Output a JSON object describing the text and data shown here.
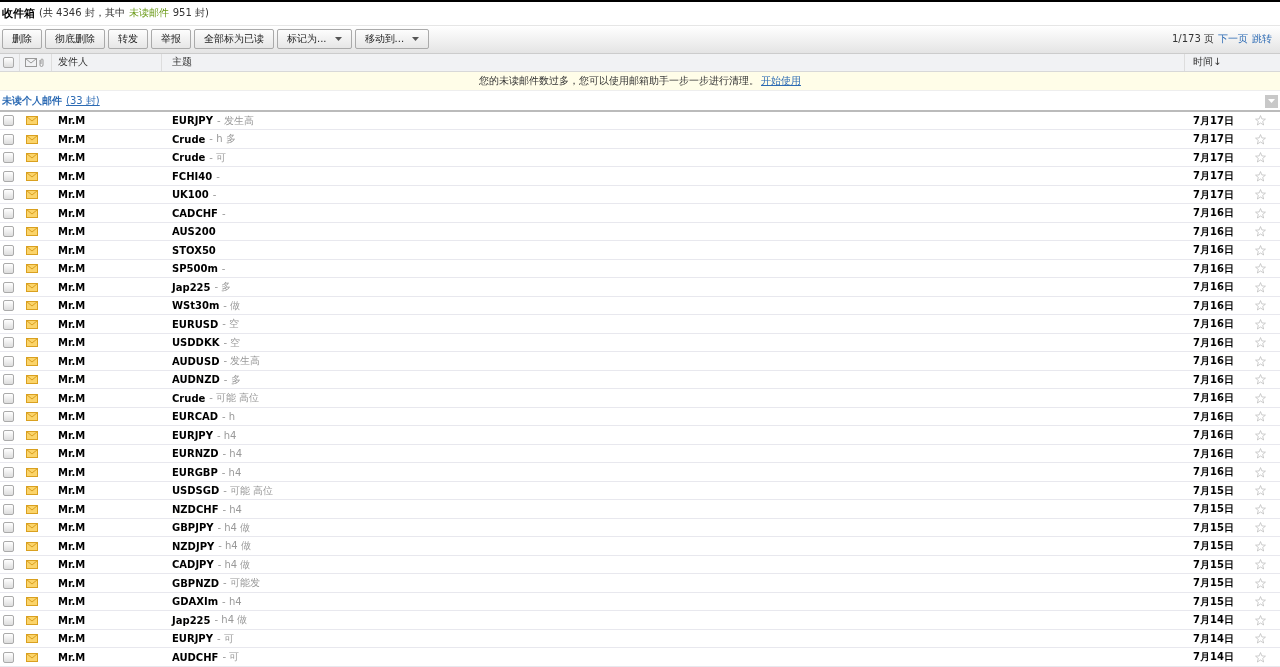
{
  "header": {
    "title": "收件箱",
    "summary_before": "(共 4346 封，其中",
    "unread_label": "未读邮件",
    "summary_after": "951 封)"
  },
  "toolbar": {
    "buttons": [
      {
        "label": "删除",
        "dropdown": false
      },
      {
        "label": "彻底删除",
        "dropdown": false
      },
      {
        "label": "转发",
        "dropdown": false
      },
      {
        "label": "举报",
        "dropdown": false
      },
      {
        "label": "全部标为已读",
        "dropdown": false
      },
      {
        "label": "标记为...",
        "dropdown": true
      },
      {
        "label": "移动到...",
        "dropdown": true
      }
    ],
    "pager": {
      "page": "1/173 页",
      "next": "下一页",
      "jump": "跳转"
    }
  },
  "columns": {
    "select_all": false,
    "sender": "发件人",
    "subject": "主题",
    "time": "时间↓"
  },
  "notice": {
    "text": "您的未读邮件数过多，您可以使用邮箱助手一步一步进行清理。",
    "link": "开始使用"
  },
  "group": {
    "title": "未读个人邮件",
    "count": "(33 封)"
  },
  "rows": [
    {
      "sender": "Mr.M",
      "subject": "EURJPY",
      "preview": "- 发生高",
      "time": "7月17日",
      "unread": true,
      "checked": false,
      "starred": false
    },
    {
      "sender": "Mr.M",
      "subject": "Crude",
      "preview": "- h 多",
      "time": "7月17日",
      "unread": true,
      "checked": false,
      "starred": false
    },
    {
      "sender": "Mr.M",
      "subject": "Crude",
      "preview": "- 可",
      "time": "7月17日",
      "unread": true,
      "checked": false,
      "starred": false
    },
    {
      "sender": "Mr.M",
      "subject": "FCHI40",
      "preview": "-",
      "time": "7月17日",
      "unread": true,
      "checked": false,
      "starred": false
    },
    {
      "sender": "Mr.M",
      "subject": "UK100",
      "preview": "-",
      "time": "7月17日",
      "unread": true,
      "checked": false,
      "starred": false
    },
    {
      "sender": "Mr.M",
      "subject": "CADCHF",
      "preview": "-",
      "time": "7月16日",
      "unread": true,
      "checked": false,
      "starred": false
    },
    {
      "sender": "Mr.M",
      "subject": "AUS200",
      "time": "7月16日",
      "unread": true,
      "checked": false,
      "starred": false
    },
    {
      "sender": "Mr.M",
      "subject": "STOX50",
      "time": "7月16日",
      "unread": true,
      "checked": false,
      "starred": false
    },
    {
      "sender": "Mr.M",
      "subject": "SP500m",
      "preview": "-",
      "time": "7月16日",
      "unread": true,
      "checked": false,
      "starred": false
    },
    {
      "sender": "Mr.M",
      "subject": "Jap225",
      "preview": "- 多",
      "time": "7月16日",
      "unread": true,
      "checked": false,
      "starred": false
    },
    {
      "sender": "Mr.M",
      "subject": "WSt30m",
      "preview": "- 做",
      "time": "7月16日",
      "unread": true,
      "checked": false,
      "starred": false
    },
    {
      "sender": "Mr.M",
      "subject": "EURUSD",
      "preview": "- 空",
      "time": "7月16日",
      "unread": true,
      "checked": false,
      "starred": false
    },
    {
      "sender": "Mr.M",
      "subject": "USDDKK",
      "preview": "- 空",
      "time": "7月16日",
      "unread": true,
      "checked": false,
      "starred": false
    },
    {
      "sender": "Mr.M",
      "subject": "AUDUSD",
      "preview": "- 发生高",
      "time": "7月16日",
      "unread": true,
      "checked": false,
      "starred": false
    },
    {
      "sender": "Mr.M",
      "subject": "AUDNZD",
      "preview": "- 多",
      "time": "7月16日",
      "unread": true,
      "checked": false,
      "starred": false
    },
    {
      "sender": "Mr.M",
      "subject": "Crude",
      "preview": "- 可能 高位",
      "time": "7月16日",
      "unread": true,
      "checked": false,
      "starred": false
    },
    {
      "sender": "Mr.M",
      "subject": "EURCAD",
      "preview": "- h",
      "time": "7月16日",
      "unread": true,
      "checked": false,
      "starred": false
    },
    {
      "sender": "Mr.M",
      "subject": "EURJPY",
      "preview": "- h4",
      "time": "7月16日",
      "unread": true,
      "checked": false,
      "starred": false
    },
    {
      "sender": "Mr.M",
      "subject": "EURNZD",
      "preview": "- h4",
      "time": "7月16日",
      "unread": true,
      "checked": false,
      "starred": false
    },
    {
      "sender": "Mr.M",
      "subject": "EURGBP",
      "preview": "- h4",
      "time": "7月16日",
      "unread": true,
      "checked": false,
      "starred": false
    },
    {
      "sender": "Mr.M",
      "subject": "USDSGD",
      "preview": "- 可能 高位",
      "time": "7月15日",
      "unread": true,
      "checked": false,
      "starred": false
    },
    {
      "sender": "Mr.M",
      "subject": "NZDCHF",
      "preview": "- h4",
      "time": "7月15日",
      "unread": true,
      "checked": false,
      "starred": false
    },
    {
      "sender": "Mr.M",
      "subject": "GBPJPY",
      "preview": "- h4 做",
      "time": "7月15日",
      "unread": true,
      "checked": false,
      "starred": false
    },
    {
      "sender": "Mr.M",
      "subject": "NZDJPY",
      "preview": "- h4 做",
      "time": "7月15日",
      "unread": true,
      "checked": false,
      "starred": false
    },
    {
      "sender": "Mr.M",
      "subject": "CADJPY",
      "preview": "- h4 做",
      "time": "7月15日",
      "unread": true,
      "checked": false,
      "starred": false
    },
    {
      "sender": "Mr.M",
      "subject": "GBPNZD",
      "preview": "- 可能发",
      "time": "7月15日",
      "unread": true,
      "checked": false,
      "starred": false
    },
    {
      "sender": "Mr.M",
      "subject": "GDAXIm",
      "preview": "- h4",
      "time": "7月15日",
      "unread": true,
      "checked": false,
      "starred": false
    },
    {
      "sender": "Mr.M",
      "subject": "Jap225",
      "preview": "- h4 做",
      "time": "7月14日",
      "unread": true,
      "checked": false,
      "starred": false
    },
    {
      "sender": "Mr.M",
      "subject": "EURJPY",
      "preview": "- 可",
      "time": "7月14日",
      "unread": true,
      "checked": false,
      "starred": false
    },
    {
      "sender": "Mr.M",
      "subject": "AUDCHF",
      "preview": "- 可",
      "time": "7月14日",
      "unread": true,
      "checked": false,
      "starred": false
    }
  ]
}
